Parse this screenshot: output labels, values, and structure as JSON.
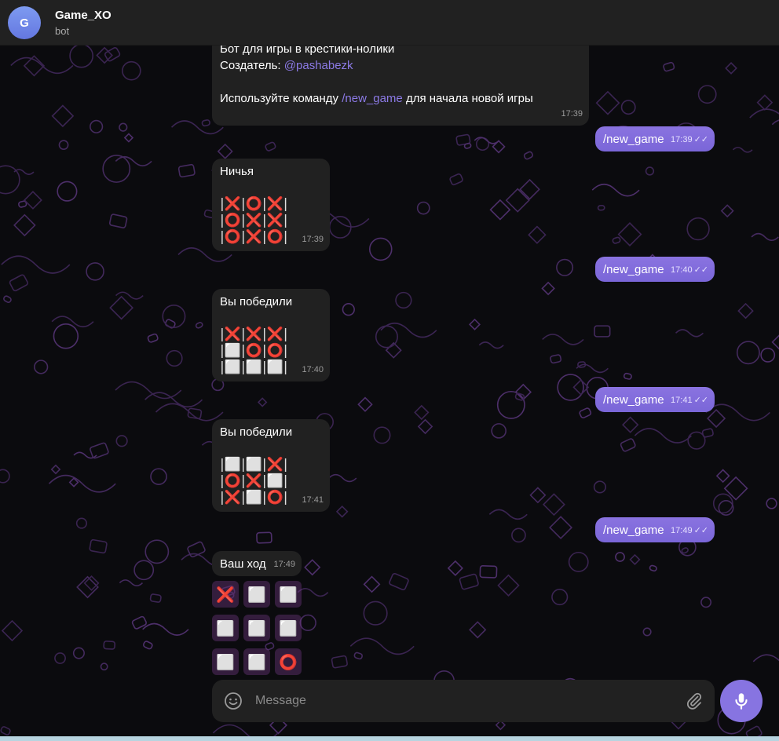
{
  "header": {
    "avatar_letter": "G",
    "title": "Game_XO",
    "subtitle": "bot"
  },
  "messages": {
    "welcome": {
      "line1": "Бот для игры в крестики-нолики",
      "creator_label": "Создатель: ",
      "creator_link": "@pashabezk",
      "use_prefix": "Используйте команду ",
      "command_link": "/new_game",
      "use_suffix": " для начала новой игры",
      "time": "17:39"
    },
    "cmd1": {
      "text": "/new_game",
      "time": "17:39"
    },
    "draw": {
      "title": "Ничья",
      "time": "17:39",
      "board": [
        [
          "x",
          "o",
          "x"
        ],
        [
          "o",
          "x",
          "x"
        ],
        [
          "o",
          "x",
          "o"
        ]
      ]
    },
    "cmd2": {
      "text": "/new_game",
      "time": "17:40"
    },
    "win1": {
      "title": "Вы победили",
      "time": "17:40",
      "board": [
        [
          "x",
          "x",
          "x"
        ],
        [
          "e",
          "o",
          "o"
        ],
        [
          "e",
          "e",
          "e"
        ]
      ]
    },
    "cmd3": {
      "text": "/new_game",
      "time": "17:41"
    },
    "win2": {
      "title": "Вы победили",
      "time": "17:41",
      "board": [
        [
          "e",
          "e",
          "x"
        ],
        [
          "o",
          "x",
          "e"
        ],
        [
          "x",
          "e",
          "o"
        ]
      ]
    },
    "cmd4": {
      "text": "/new_game",
      "time": "17:49"
    },
    "turn": {
      "title": "Ваш ход",
      "time": "17:49"
    }
  },
  "keyboard": [
    [
      "x",
      "e",
      "e"
    ],
    [
      "e",
      "e",
      "e"
    ],
    [
      "e",
      "e",
      "o"
    ]
  ],
  "symbols": {
    "x": "❌",
    "o": "⭕",
    "e": "⬜",
    "sep": "|"
  },
  "composer": {
    "placeholder": "Message"
  },
  "colors": {
    "accent": "#8774e1",
    "bubble_in": "#212121",
    "link": "#8c7ae6",
    "mark": "#e03030"
  }
}
